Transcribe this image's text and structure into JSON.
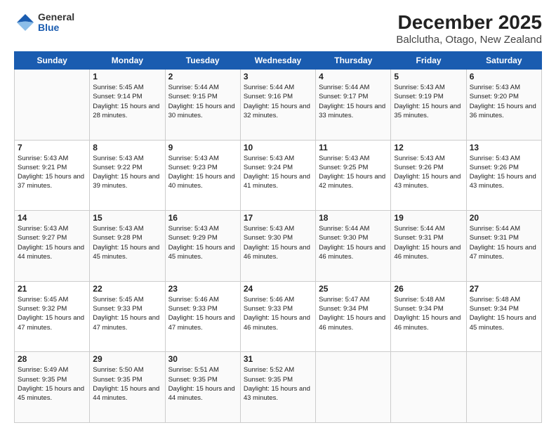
{
  "header": {
    "logo": {
      "general": "General",
      "blue": "Blue"
    },
    "title": "December 2025",
    "subtitle": "Balclutha, Otago, New Zealand"
  },
  "days_of_week": [
    "Sunday",
    "Monday",
    "Tuesday",
    "Wednesday",
    "Thursday",
    "Friday",
    "Saturday"
  ],
  "weeks": [
    [
      {
        "day": "",
        "sunrise": "",
        "sunset": "",
        "daylight": ""
      },
      {
        "day": "1",
        "sunrise": "Sunrise: 5:45 AM",
        "sunset": "Sunset: 9:14 PM",
        "daylight": "Daylight: 15 hours and 28 minutes."
      },
      {
        "day": "2",
        "sunrise": "Sunrise: 5:44 AM",
        "sunset": "Sunset: 9:15 PM",
        "daylight": "Daylight: 15 hours and 30 minutes."
      },
      {
        "day": "3",
        "sunrise": "Sunrise: 5:44 AM",
        "sunset": "Sunset: 9:16 PM",
        "daylight": "Daylight: 15 hours and 32 minutes."
      },
      {
        "day": "4",
        "sunrise": "Sunrise: 5:44 AM",
        "sunset": "Sunset: 9:17 PM",
        "daylight": "Daylight: 15 hours and 33 minutes."
      },
      {
        "day": "5",
        "sunrise": "Sunrise: 5:43 AM",
        "sunset": "Sunset: 9:19 PM",
        "daylight": "Daylight: 15 hours and 35 minutes."
      },
      {
        "day": "6",
        "sunrise": "Sunrise: 5:43 AM",
        "sunset": "Sunset: 9:20 PM",
        "daylight": "Daylight: 15 hours and 36 minutes."
      }
    ],
    [
      {
        "day": "7",
        "sunrise": "Sunrise: 5:43 AM",
        "sunset": "Sunset: 9:21 PM",
        "daylight": "Daylight: 15 hours and 37 minutes."
      },
      {
        "day": "8",
        "sunrise": "Sunrise: 5:43 AM",
        "sunset": "Sunset: 9:22 PM",
        "daylight": "Daylight: 15 hours and 39 minutes."
      },
      {
        "day": "9",
        "sunrise": "Sunrise: 5:43 AM",
        "sunset": "Sunset: 9:23 PM",
        "daylight": "Daylight: 15 hours and 40 minutes."
      },
      {
        "day": "10",
        "sunrise": "Sunrise: 5:43 AM",
        "sunset": "Sunset: 9:24 PM",
        "daylight": "Daylight: 15 hours and 41 minutes."
      },
      {
        "day": "11",
        "sunrise": "Sunrise: 5:43 AM",
        "sunset": "Sunset: 9:25 PM",
        "daylight": "Daylight: 15 hours and 42 minutes."
      },
      {
        "day": "12",
        "sunrise": "Sunrise: 5:43 AM",
        "sunset": "Sunset: 9:26 PM",
        "daylight": "Daylight: 15 hours and 43 minutes."
      },
      {
        "day": "13",
        "sunrise": "Sunrise: 5:43 AM",
        "sunset": "Sunset: 9:26 PM",
        "daylight": "Daylight: 15 hours and 43 minutes."
      }
    ],
    [
      {
        "day": "14",
        "sunrise": "Sunrise: 5:43 AM",
        "sunset": "Sunset: 9:27 PM",
        "daylight": "Daylight: 15 hours and 44 minutes."
      },
      {
        "day": "15",
        "sunrise": "Sunrise: 5:43 AM",
        "sunset": "Sunset: 9:28 PM",
        "daylight": "Daylight: 15 hours and 45 minutes."
      },
      {
        "day": "16",
        "sunrise": "Sunrise: 5:43 AM",
        "sunset": "Sunset: 9:29 PM",
        "daylight": "Daylight: 15 hours and 45 minutes."
      },
      {
        "day": "17",
        "sunrise": "Sunrise: 5:43 AM",
        "sunset": "Sunset: 9:30 PM",
        "daylight": "Daylight: 15 hours and 46 minutes."
      },
      {
        "day": "18",
        "sunrise": "Sunrise: 5:44 AM",
        "sunset": "Sunset: 9:30 PM",
        "daylight": "Daylight: 15 hours and 46 minutes."
      },
      {
        "day": "19",
        "sunrise": "Sunrise: 5:44 AM",
        "sunset": "Sunset: 9:31 PM",
        "daylight": "Daylight: 15 hours and 46 minutes."
      },
      {
        "day": "20",
        "sunrise": "Sunrise: 5:44 AM",
        "sunset": "Sunset: 9:31 PM",
        "daylight": "Daylight: 15 hours and 47 minutes."
      }
    ],
    [
      {
        "day": "21",
        "sunrise": "Sunrise: 5:45 AM",
        "sunset": "Sunset: 9:32 PM",
        "daylight": "Daylight: 15 hours and 47 minutes."
      },
      {
        "day": "22",
        "sunrise": "Sunrise: 5:45 AM",
        "sunset": "Sunset: 9:33 PM",
        "daylight": "Daylight: 15 hours and 47 minutes."
      },
      {
        "day": "23",
        "sunrise": "Sunrise: 5:46 AM",
        "sunset": "Sunset: 9:33 PM",
        "daylight": "Daylight: 15 hours and 47 minutes."
      },
      {
        "day": "24",
        "sunrise": "Sunrise: 5:46 AM",
        "sunset": "Sunset: 9:33 PM",
        "daylight": "Daylight: 15 hours and 46 minutes."
      },
      {
        "day": "25",
        "sunrise": "Sunrise: 5:47 AM",
        "sunset": "Sunset: 9:34 PM",
        "daylight": "Daylight: 15 hours and 46 minutes."
      },
      {
        "day": "26",
        "sunrise": "Sunrise: 5:48 AM",
        "sunset": "Sunset: 9:34 PM",
        "daylight": "Daylight: 15 hours and 46 minutes."
      },
      {
        "day": "27",
        "sunrise": "Sunrise: 5:48 AM",
        "sunset": "Sunset: 9:34 PM",
        "daylight": "Daylight: 15 hours and 45 minutes."
      }
    ],
    [
      {
        "day": "28",
        "sunrise": "Sunrise: 5:49 AM",
        "sunset": "Sunset: 9:35 PM",
        "daylight": "Daylight: 15 hours and 45 minutes."
      },
      {
        "day": "29",
        "sunrise": "Sunrise: 5:50 AM",
        "sunset": "Sunset: 9:35 PM",
        "daylight": "Daylight: 15 hours and 44 minutes."
      },
      {
        "day": "30",
        "sunrise": "Sunrise: 5:51 AM",
        "sunset": "Sunset: 9:35 PM",
        "daylight": "Daylight: 15 hours and 44 minutes."
      },
      {
        "day": "31",
        "sunrise": "Sunrise: 5:52 AM",
        "sunset": "Sunset: 9:35 PM",
        "daylight": "Daylight: 15 hours and 43 minutes."
      },
      {
        "day": "",
        "sunrise": "",
        "sunset": "",
        "daylight": ""
      },
      {
        "day": "",
        "sunrise": "",
        "sunset": "",
        "daylight": ""
      },
      {
        "day": "",
        "sunrise": "",
        "sunset": "",
        "daylight": ""
      }
    ]
  ]
}
